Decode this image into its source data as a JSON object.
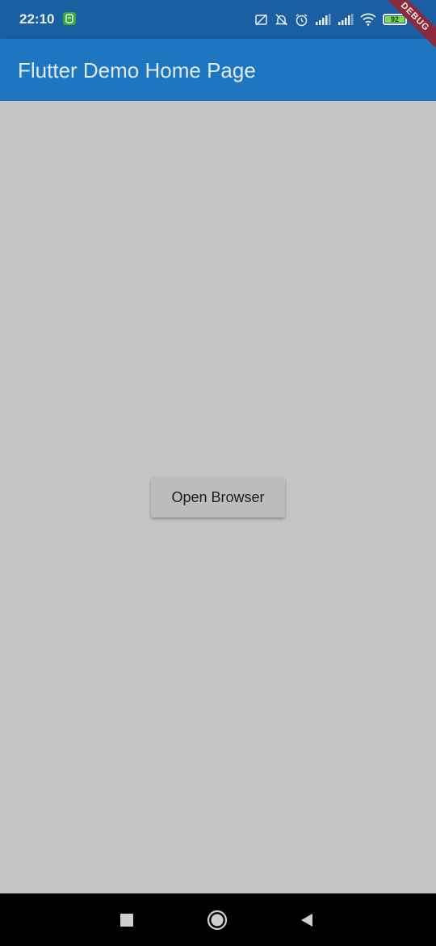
{
  "status_bar": {
    "time": "22:10",
    "battery_level": "92",
    "icons": [
      "screen-off-icon",
      "bell-muted-icon",
      "alarm-icon",
      "signal-icon",
      "signal-icon",
      "wifi-icon",
      "battery-icon",
      "charging-icon"
    ]
  },
  "app_bar": {
    "title": "Flutter Demo Home Page",
    "debug_banner": "DEBUG"
  },
  "main": {
    "open_browser_label": "Open Browser"
  },
  "nav_bar": {
    "buttons": [
      "recents-icon",
      "home-icon",
      "back-icon"
    ]
  },
  "colors": {
    "status_bar": "#1b5fa0",
    "app_bar": "#1e76c0",
    "background": "#c4c4c4",
    "button": "#bcbcbc",
    "debug_banner": "#8b2a3c",
    "nav_bar": "#000000"
  }
}
